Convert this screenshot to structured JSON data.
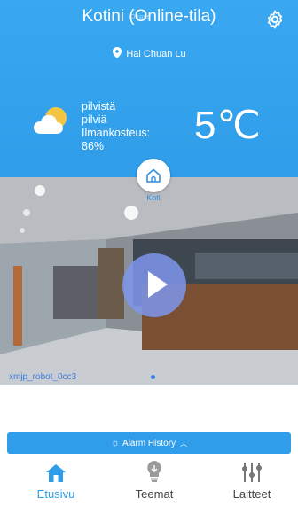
{
  "header": {
    "title": "Kotini (Online-tila)",
    "faint_overlay": "Ohjaus",
    "location": "Hai Chuan Lu"
  },
  "weather": {
    "line1": "pilvistä",
    "line2": "pilviä",
    "line3": "Ilmankosteus:",
    "line4": "86%",
    "temperature": "5℃"
  },
  "home_button": {
    "label": "Koti"
  },
  "camera": {
    "name": "xmjp_robot_0cc3"
  },
  "alarm": {
    "label": "Alarm History"
  },
  "nav": {
    "items": [
      {
        "label": "Etusivu"
      },
      {
        "label": "Teemat"
      },
      {
        "label": "Laitteet"
      }
    ]
  },
  "colors": {
    "header_blue": "#2f9de9",
    "accent": "#2f9de9",
    "play_button": "#7e96ec"
  }
}
